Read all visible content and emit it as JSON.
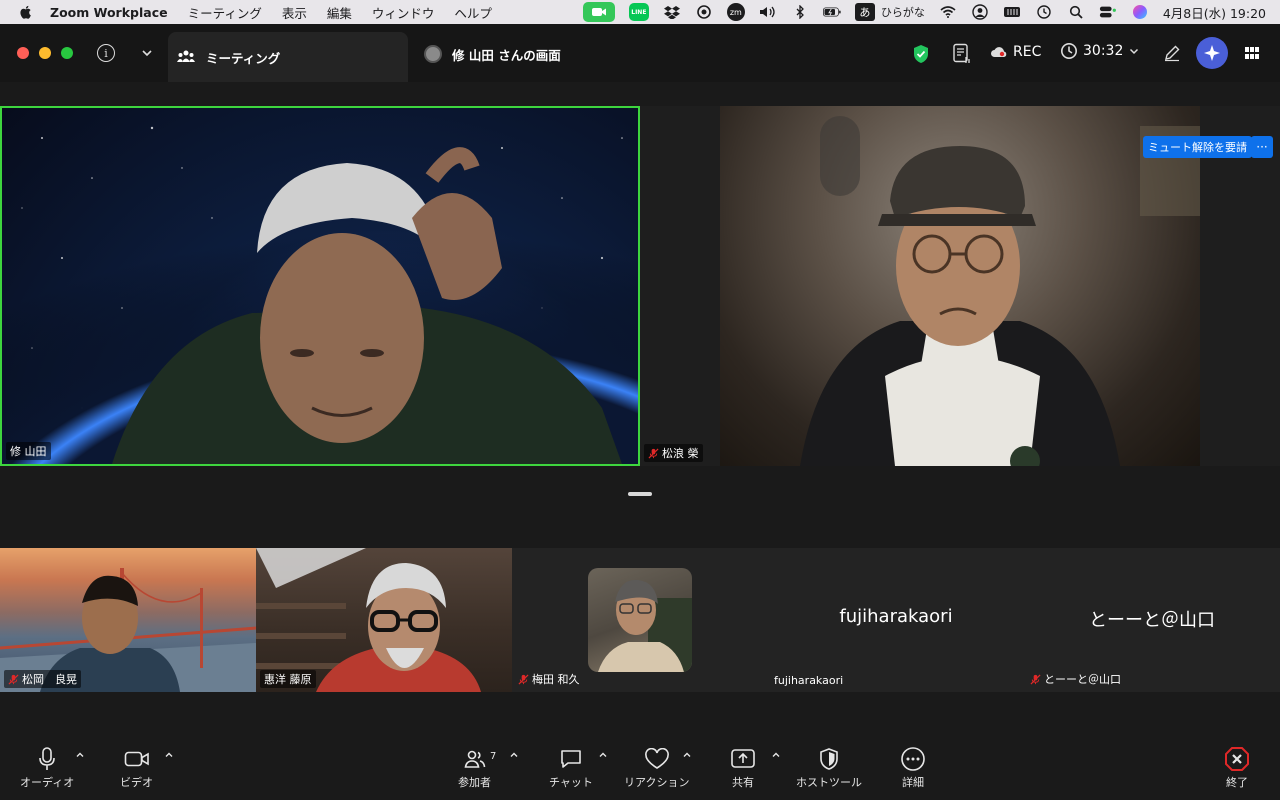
{
  "menubar": {
    "app_name": "Zoom Workplace",
    "items": [
      "ミーティング",
      "表示",
      "編集",
      "ウィンドウ",
      "ヘルプ"
    ],
    "line_label": "LINE",
    "zm_label": "zm",
    "ime_box": "あ",
    "ime_label": "ひらがな",
    "datetime": "4月8日(水)  19:20"
  },
  "titlebar": {
    "tab_meeting": "ミーティング",
    "tab_share": "修 山田 さんの画面",
    "rec_label": "REC",
    "timer": "30:32"
  },
  "stage": {
    "main": [
      {
        "name": "修 山田",
        "muted": false
      },
      {
        "name": "松浪 榮",
        "muted": true
      }
    ],
    "unmute_request": "ミュート解除を要請",
    "more": "···"
  },
  "strip": [
    {
      "name": "松岡　良晃",
      "muted": true
    },
    {
      "name": "惠洋 藤原",
      "muted": false
    },
    {
      "name": "梅田 和久",
      "muted": true
    },
    {
      "name": "fujiharakaori",
      "display": "fujiharakaori",
      "muted": false
    },
    {
      "name": "とーーと＠山口",
      "display": "とーーと＠山口",
      "muted": true
    }
  ],
  "controls": {
    "audio": "オーディオ",
    "video": "ビデオ",
    "participants": "参加者",
    "participants_count": "7",
    "chat": "チャット",
    "reactions": "リアクション",
    "share": "共有",
    "host_tools": "ホストツール",
    "more": "詳細",
    "end": "終了"
  },
  "colors": {
    "active_speaker_border": "#3ed53e",
    "accent_blue": "#0e71eb",
    "end_red": "#e02828",
    "mute_red": "#e02828"
  }
}
